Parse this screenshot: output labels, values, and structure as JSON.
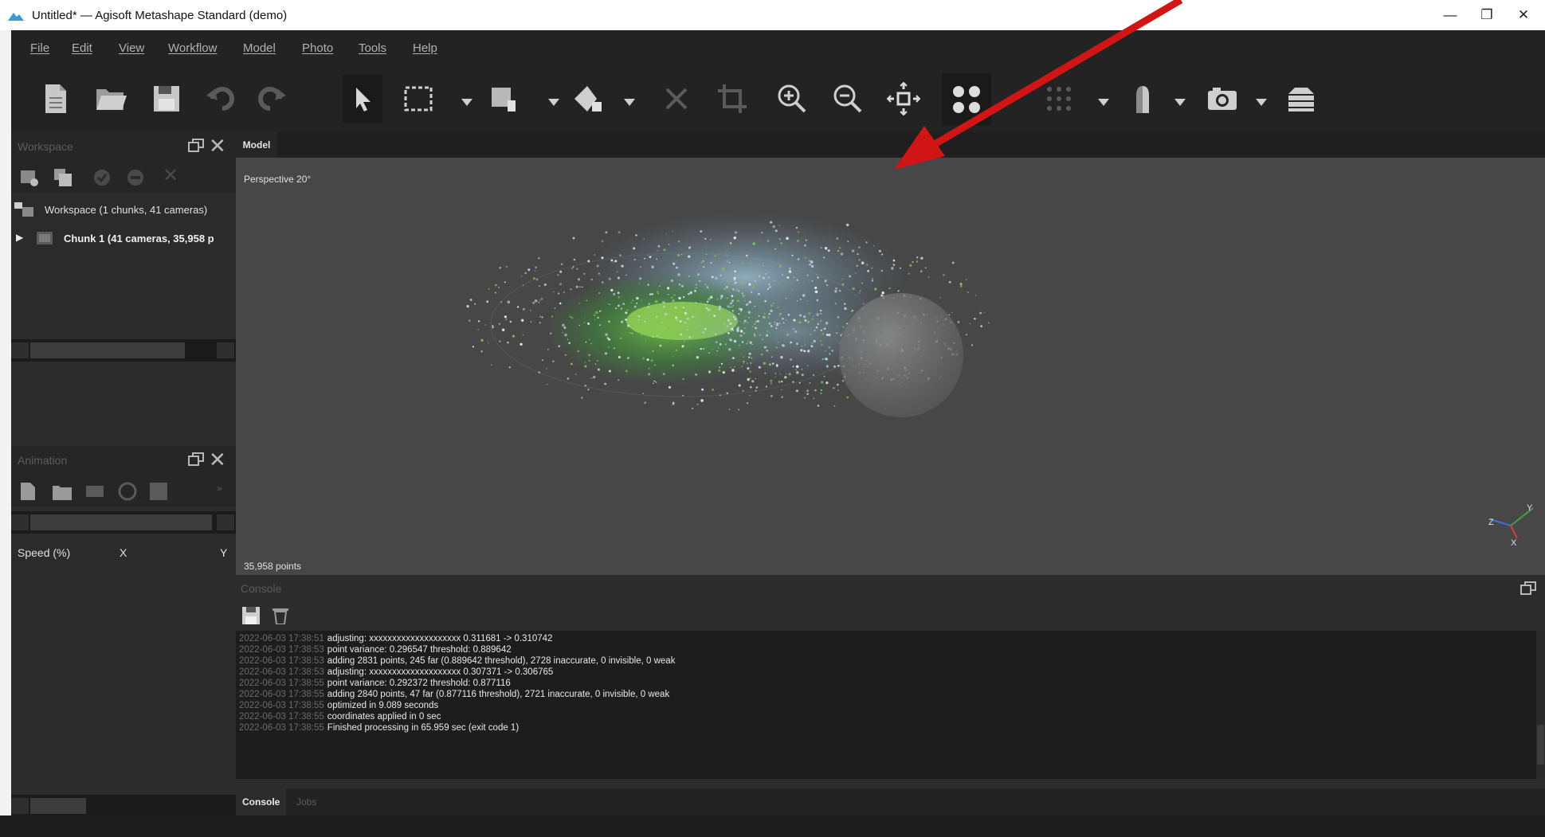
{
  "window": {
    "title": "Untitled* — Agisoft Metashape Standard (demo)",
    "minimize_glyph": "—",
    "maximize_glyph": "❐",
    "close_glyph": "✕"
  },
  "menu": [
    "File",
    "Edit",
    "View",
    "Workflow",
    "Model",
    "Photo",
    "Tools",
    "Help"
  ],
  "toolbar_icons": [
    "new-document-icon",
    "open-folder-icon",
    "save-icon",
    "undo-icon",
    "redo-icon",
    "navigation-arrow-icon",
    "rectangle-selection-icon",
    "move-region-icon",
    "rotate-region-icon",
    "delete-icon",
    "crop-icon",
    "zoom-in-icon",
    "zoom-out-icon",
    "reset-view-icon",
    "point-cloud-icon",
    "dense-cloud-icon",
    "shading-icon",
    "camera-icon",
    "layers-icon"
  ],
  "workspace": {
    "title": "Workspace",
    "root_label": "Workspace (1 chunks, 41 cameras)",
    "chunk_label": "Chunk 1 (41 cameras, 35,958 p"
  },
  "animation": {
    "title": "Animation",
    "col_speed": "Speed (%)",
    "col_x": "X",
    "col_y": "Y"
  },
  "model_view": {
    "tab_label": "Model",
    "projection_label": "Perspective 20°",
    "points_count": "35,958 points",
    "axis_z": "Z",
    "axis_y": "Y",
    "axis_x": "X"
  },
  "console": {
    "title": "Console",
    "lines": [
      {
        "time": "2022-06-03 17:38:51",
        "text": "adjusting: xxxxxxxxxxxxxxxxxxxx 0.311681 -> 0.310742"
      },
      {
        "time": "2022-06-03 17:38:53",
        "text": "point variance: 0.296547 threshold: 0.889642"
      },
      {
        "time": "2022-06-03 17:38:53",
        "text": "adding 2831 points, 245 far (0.889642 threshold), 2728 inaccurate, 0 invisible, 0 weak"
      },
      {
        "time": "2022-06-03 17:38:53",
        "text": "adjusting: xxxxxxxxxxxxxxxxxxxx 0.307371 -> 0.306765"
      },
      {
        "time": "2022-06-03 17:38:55",
        "text": "point variance: 0.292372 threshold: 0.877116"
      },
      {
        "time": "2022-06-03 17:38:55",
        "text": "adding 2840 points, 47 far (0.877116 threshold), 2721 inaccurate, 0 invisible, 0 weak"
      },
      {
        "time": "2022-06-03 17:38:55",
        "text": "optimized in 9.089 seconds"
      },
      {
        "time": "2022-06-03 17:38:55",
        "text": "coordinates applied in 0 sec"
      },
      {
        "time": "2022-06-03 17:38:55",
        "text": "Finished processing in 65.959 sec (exit code 1)"
      }
    ],
    "tab_console": "Console",
    "tab_jobs": "Jobs"
  },
  "colors": {
    "annotation_arrow": "#d11414",
    "viewport_bg": "#474747",
    "menu_bg": "#232323"
  }
}
